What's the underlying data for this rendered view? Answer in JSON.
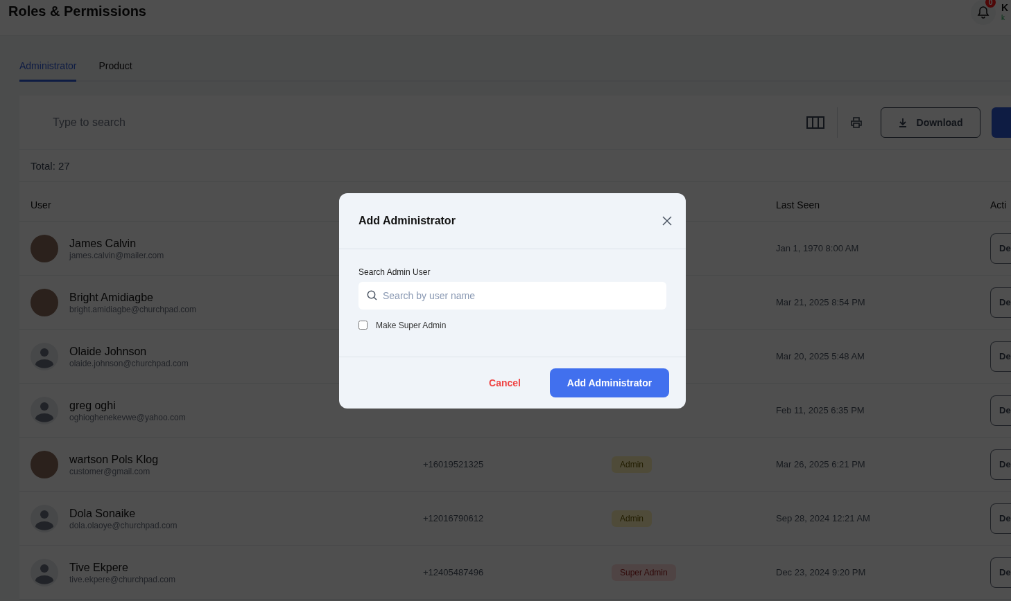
{
  "header": {
    "title": "Roles & Permissions",
    "notification_count": "0",
    "user_name": "K",
    "user_sub": "k"
  },
  "tabs": [
    {
      "label": "Administrator",
      "selected": true
    },
    {
      "label": "Product",
      "selected": false
    }
  ],
  "toolbar": {
    "search_placeholder": "Type to search",
    "download_label": "Download"
  },
  "total": "Total: 27",
  "table": {
    "columns": {
      "user": "User",
      "last_seen": "Last Seen",
      "action": "Acti"
    },
    "rows": [
      {
        "name": "James Calvin",
        "email": "james.calvin@mailer.com",
        "kind": "photo",
        "last_seen": "Jan 1, 1970 8:00 AM",
        "action": "De"
      },
      {
        "name": "Bright Amidiagbe",
        "email": "bright.amidiagbe@churchpad.com",
        "kind": "photo",
        "last_seen": "Mar 21, 2025 8:54 PM",
        "action": "De"
      },
      {
        "name": "Olaide Johnson",
        "email": "olaide.johnson@churchpad.com",
        "kind": "default",
        "last_seen": "Mar 20, 2025 5:48 AM",
        "action": "De"
      },
      {
        "name": "greg oghi",
        "email": "oghioghenekevwe@yahoo.com",
        "kind": "default",
        "last_seen": "Feb 11, 2025 6:35 PM",
        "action": "De"
      },
      {
        "name": "wartson Pols Klog",
        "email": "customer@gmail.com",
        "kind": "photo",
        "phone": "+16019521325",
        "role": {
          "label": "Admin",
          "kind": "admin"
        },
        "last_seen": "Mar 26, 2025 6:21 PM",
        "action": "De"
      },
      {
        "name": "Dola Sonaike",
        "email": "dola.olaoye@churchpad.com",
        "kind": "default",
        "phone": "+12016790612",
        "role": {
          "label": "Admin",
          "kind": "admin"
        },
        "last_seen": "Sep 28, 2024 12:21 AM",
        "action": "De"
      },
      {
        "name": "Tive Ekpere",
        "email": "tive.ekpere@churchpad.com",
        "kind": "default",
        "phone": "+12405487496",
        "role": {
          "label": "Super Admin",
          "kind": "super"
        },
        "last_seen": "Dec 23, 2024 9:20 PM",
        "action": "De"
      }
    ]
  },
  "modal": {
    "title": "Add Administrator",
    "field_label": "Search Admin User",
    "placeholder": "Search by user name",
    "checkbox": {
      "label": "Make Super Admin",
      "checked": false
    },
    "cancel": "Cancel",
    "confirm": "Add Administrator"
  }
}
